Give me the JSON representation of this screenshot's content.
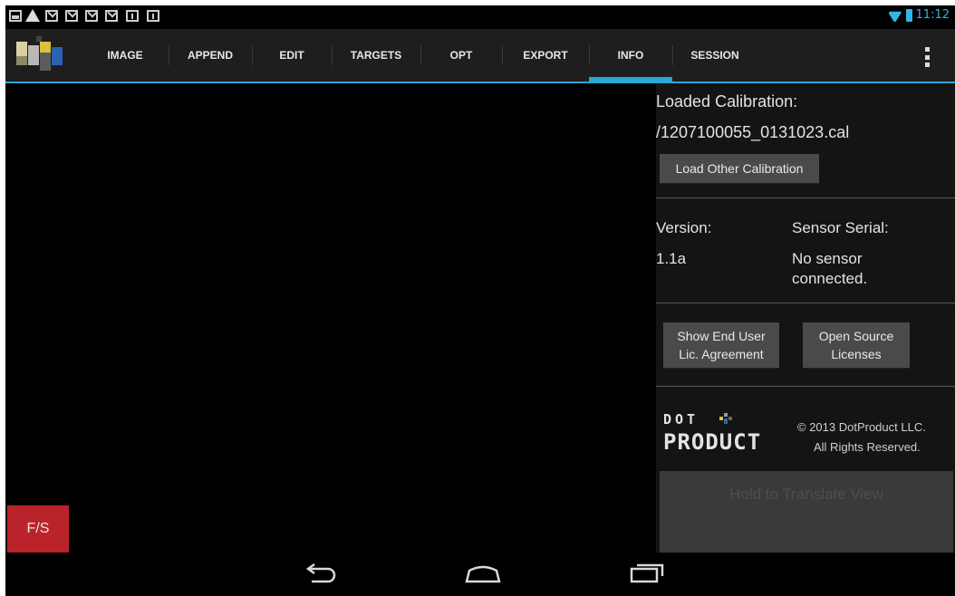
{
  "status_bar": {
    "notification_icons": [
      "image-icon",
      "warning-icon",
      "mail-icon",
      "mail-icon",
      "mail-icon",
      "mail-icon",
      "calendar-icon",
      "calendar-icon"
    ],
    "time": "11:12",
    "accent": "#33b5e5"
  },
  "action_bar": {
    "logo_icon": "dotproduct-logo-icon",
    "tabs": [
      {
        "label": "IMAGE"
      },
      {
        "label": "APPEND"
      },
      {
        "label": "EDIT"
      },
      {
        "label": "TARGETS"
      },
      {
        "label": "OPT"
      },
      {
        "label": "EXPORT"
      },
      {
        "label": "INFO",
        "active": true
      },
      {
        "label": "SESSION"
      }
    ],
    "overflow_icon": "overflow-menu-icon",
    "accent": "#2aa6d9"
  },
  "viewport": {
    "fs_button": "F/S",
    "fs_color": "#b9242a"
  },
  "info_panel": {
    "calibration_heading": "Loaded Calibration:",
    "calibration_file": "/1207100055_0131023.cal",
    "load_other_button": "Load Other Calibration",
    "version_label": "Version:",
    "version_value": "1.1a",
    "sensor_serial_label": "Sensor Serial:",
    "sensor_serial_value_line1": "No sensor",
    "sensor_serial_value_line2": "connected.",
    "eula_button_line1": "Show End User",
    "eula_button_line2": "Lic. Agreement",
    "oss_button_line1": "Open Source",
    "oss_button_line2": "Licenses",
    "brand_line1": "DOT",
    "brand_line2": "PRODUCT",
    "copyright_line1": "© 2013 DotProduct LLC.",
    "copyright_line2": "All Rights Reserved.",
    "translate_button": "Hold to Translate View"
  },
  "nav_bar": {
    "icons": [
      "back-icon",
      "home-icon",
      "recent-apps-icon"
    ]
  }
}
